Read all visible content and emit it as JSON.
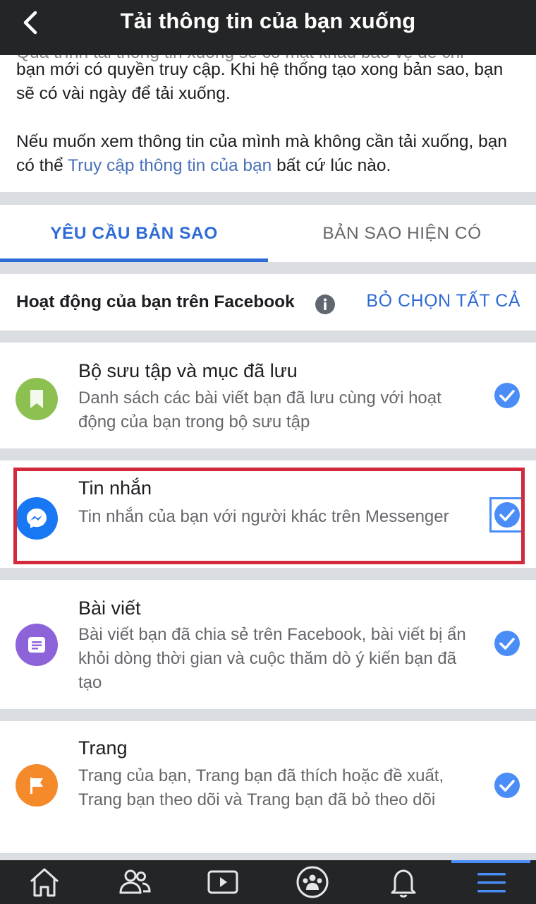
{
  "header": {
    "title": "Tải thông tin của bạn xuống"
  },
  "intro": {
    "cut_line": "Quá trình tải thông tin xuống sẽ có mật khẩu bảo vệ để chỉ",
    "para1": "bạn mới có quyền truy cập. Khi hệ thống tạo xong bản sao, bạn sẽ có vài ngày để tải xuống.",
    "para2_before": "Nếu muốn xem thông tin của mình mà không cần tải xuống, bạn có thể ",
    "para2_link": "Truy cập thông tin của bạn",
    "para2_after": " bất cứ lúc nào."
  },
  "tabs": {
    "request_copy": "YÊU CẦU BẢN SAO",
    "available_copies": "BẢN SAO HIỆN CÓ"
  },
  "section": {
    "title": "Hoạt động của bạn trên Facebook",
    "deselect_all": "BỎ CHỌN TẤT CẢ"
  },
  "items": [
    {
      "title": "Bộ sưu tập và mục đã lưu",
      "desc": "Danh sách các bài viết bạn đã lưu cùng với hoạt động của bạn trong bộ sưu tập",
      "icon": "bookmark-icon",
      "icon_color": "#8cc152",
      "checked": true
    },
    {
      "title": "Tin nhắn",
      "desc": "Tin nhắn của bạn với người khác trên Messenger",
      "icon": "messenger-icon",
      "icon_color": "#1877f2",
      "checked": true
    },
    {
      "title": "Bài viết",
      "desc": "Bài viết bạn đã chia sẻ trên Facebook, bài viết bị ẩn khỏi dòng thời gian và cuộc thăm dò ý kiến bạn đã tạo",
      "icon": "post-icon",
      "icon_color": "#8c63d9",
      "checked": true
    },
    {
      "title": "Trang",
      "desc": "Trang của bạn, Trang bạn đã thích hoặc đề xuất, Trang bạn theo dõi và Trang bạn đã bỏ theo dõi",
      "icon": "flag-icon",
      "icon_color": "#f58a2b",
      "checked": true
    }
  ],
  "nav": [
    "home-icon",
    "friends-icon",
    "watch-icon",
    "groups-icon",
    "notifications-icon",
    "menu-icon"
  ],
  "colors": {
    "accent": "#2e6bd6",
    "check": "#4a8df7",
    "highlight": "#d2293d",
    "header_bg": "#242526"
  }
}
